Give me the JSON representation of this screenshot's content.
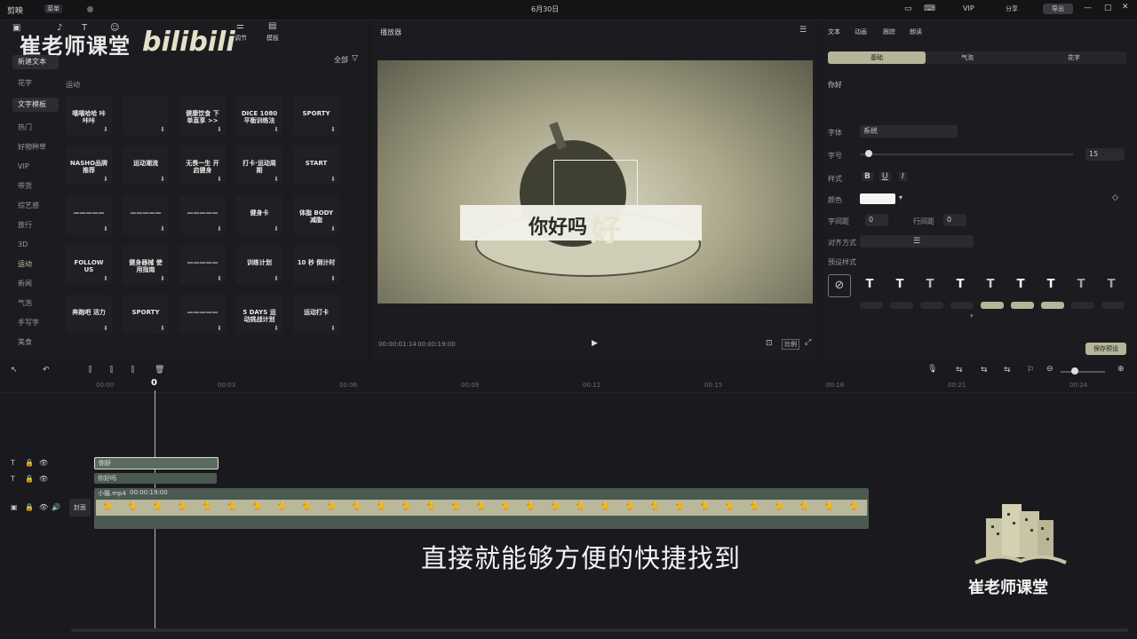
{
  "window": {
    "app_name": "剪映",
    "menu": "菜单",
    "date_title": "6月30日",
    "vip_label": "VIP",
    "share_label": "分享",
    "export_label": "导出"
  },
  "toolbar": {
    "tabs": [
      "媒体",
      "音频",
      "文本",
      "贴纸",
      "特效",
      "转场",
      "调节",
      "模板"
    ]
  },
  "left_sidebar": {
    "items": [
      "新建文本",
      "花字",
      "文字模板",
      "热门",
      "好物种草",
      "VIP",
      "带货",
      "综艺感",
      "旅行",
      "3D",
      "运动",
      "新闻",
      "气泡",
      "手写字",
      "美食"
    ]
  },
  "assets": {
    "filter_label": "全部",
    "section_title": "运动",
    "tiles": [
      "嘻嘻哈哈 咔咔咔",
      "",
      "健康饮食 下单直享 >>",
      "DICE 1080 平衡训练法",
      "SPORTY",
      "NASHO品牌推荐",
      "运动潮流",
      "无畏一生 开启健身",
      "打卡·运动周期",
      "START",
      "—————",
      "—————",
      "—————",
      "健身卡",
      "体脂 BODY 减脂",
      "FOLLOW US",
      "健身器械 使用指南",
      "—————",
      "训练计划",
      "10 秒 倒计时",
      "奔跑吧 活力",
      "SPORTY",
      "—————",
      "5 DAYS 运动挑战计划",
      "运动打卡"
    ]
  },
  "player": {
    "title": "播放器",
    "overlay_text": "你好吗",
    "overlay_text_2": "好",
    "current_time": "00:00:01:14",
    "total_time": "00:00:19:00",
    "ratio_label": "比例"
  },
  "right_panel": {
    "tabs": [
      "文本",
      "动画",
      "跟踪",
      "朗读"
    ],
    "subtabs": [
      "基础",
      "气泡",
      "花字"
    ],
    "text_value": "你好",
    "font_label": "字体",
    "font_value": "系统",
    "size_label": "字号",
    "size_value": "15",
    "style_label": "样式",
    "color_label": "颜色",
    "char_spacing_label": "字间距",
    "char_spacing_value": "0",
    "line_spacing_label": "行间距",
    "line_spacing_value": "0",
    "align_label": "对齐方式",
    "preset_label": "预设样式",
    "save_preset_label": "保存预设",
    "preset_letter": "T"
  },
  "timeline": {
    "ruler": [
      "00:00",
      "00:03",
      "00:06",
      "00:09",
      "00:12",
      "00:15",
      "00:18",
      "00:21",
      "00:24"
    ],
    "playhead_label": "0",
    "text_clip_1": "你好",
    "text_clip_2": "你好吗",
    "video_clip_name": "小猫.mp4",
    "video_clip_duration": "00:00:19:00",
    "cover_label": "封面"
  },
  "overlays": {
    "subtitle": "直接就能够方便的快捷找到",
    "watermark_brand": "崔老师课堂",
    "watermark_site": "bilibili",
    "logo_caption": "崔老师课堂"
  },
  "colors": {
    "accent": "#b5b59a",
    "panel": "#1c1c20",
    "background": "#1a1a1e",
    "video_track": "#4a5a50"
  }
}
